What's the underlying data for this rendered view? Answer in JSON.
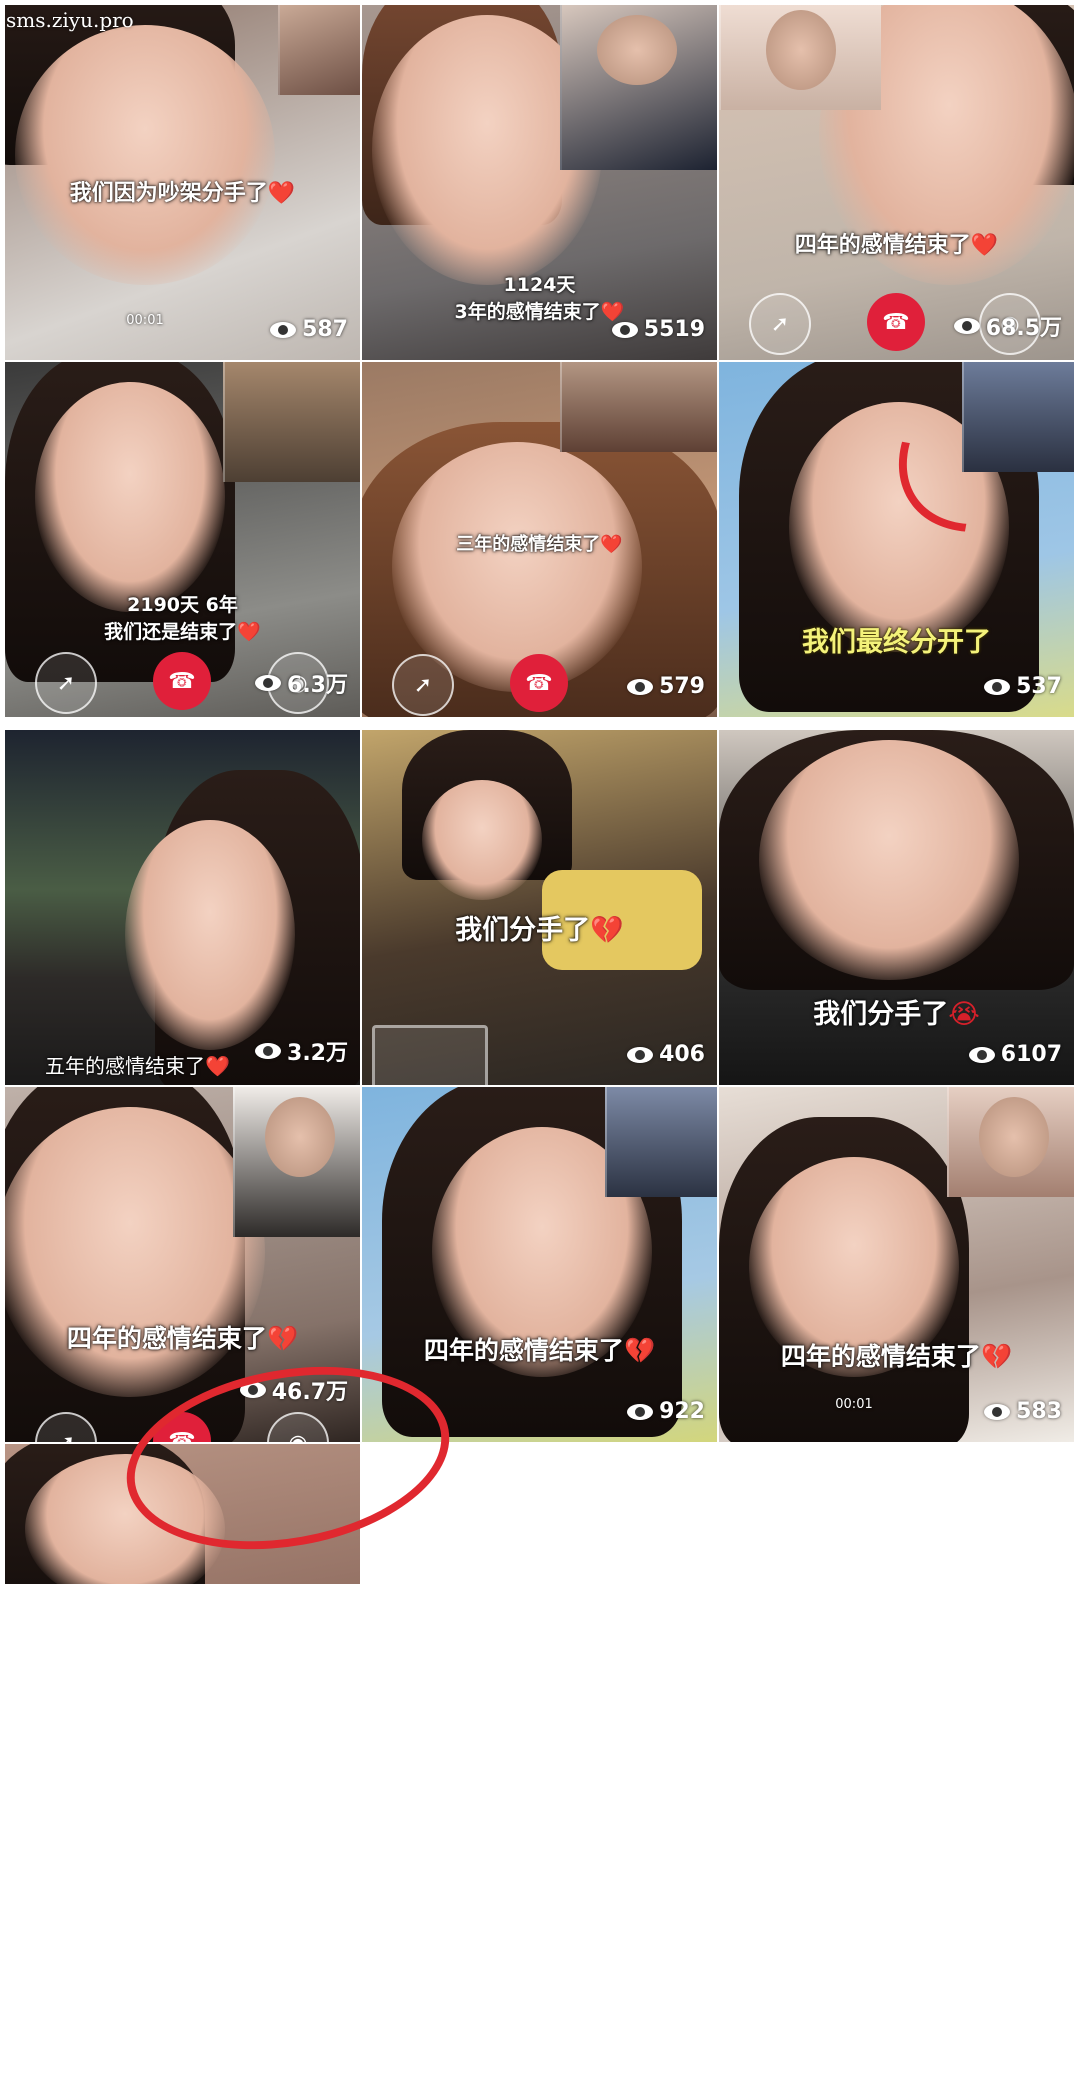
{
  "watermark": "sms.ziyu.pro",
  "tiles": [
    {
      "caption": "我们因为吵架分手了",
      "heart": "❤️",
      "views": "587",
      "timer": "00:01"
    },
    {
      "caption": "1124天\n3年的感情结束了",
      "heart": "❤️",
      "views": "5519"
    },
    {
      "caption": "四年的感情结束了",
      "heart": "❤️",
      "views": "68.5万"
    },
    {
      "caption": "2190天 6年\n我们还是结束了",
      "heart": "❤️",
      "views": "6.3万"
    },
    {
      "caption": "三年的感情结束了",
      "heart": "❤️",
      "views": "579"
    },
    {
      "caption": "我们最终分开了",
      "heart": "",
      "views": "537"
    },
    {
      "caption": "五年的感情结束了",
      "heart": "❤️",
      "views": "3.2万"
    },
    {
      "caption": "我们分手了",
      "heart": "💔",
      "views": "406"
    },
    {
      "caption": "我们分手了",
      "heart": "😭",
      "views": "6107"
    },
    {
      "caption": "四年的感情结束了",
      "heart": "💔",
      "views": "46.7万"
    },
    {
      "caption": "四年的感情结束了",
      "heart": "💔",
      "views": "922"
    },
    {
      "caption": "四年的感情结束了",
      "heart": "💔",
      "views": "583",
      "timer": "00:01"
    }
  ],
  "colors": {
    "annotation": "#e0282f",
    "hangup": "#e0203a",
    "caption_yellow": "#f4f27a"
  },
  "icons": [
    "eye-icon",
    "heart-icon",
    "phone-hangup-icon",
    "speaker-icon",
    "camera-icon"
  ]
}
